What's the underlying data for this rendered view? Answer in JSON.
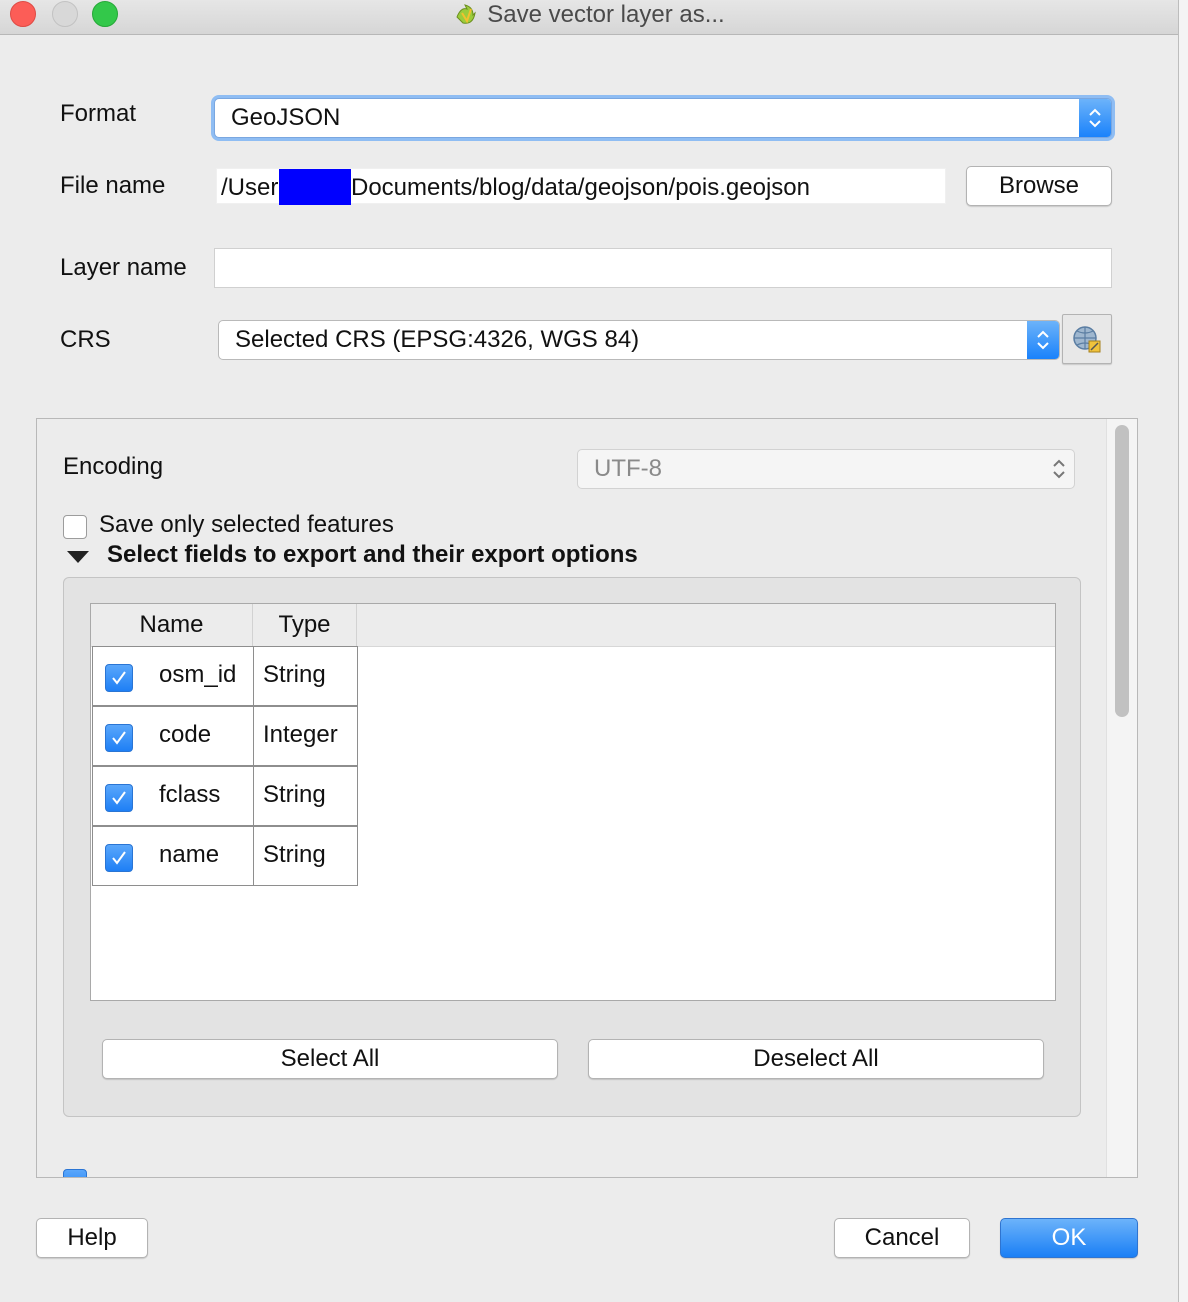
{
  "window": {
    "title": "Save vector layer as..."
  },
  "form": {
    "format_label": "Format",
    "format_value": "GeoJSON",
    "filename_label": "File name",
    "filename_prefix": "/User",
    "filename_suffix": "Documents/blog/data/geojson/pois.geojson",
    "browse_label": "Browse",
    "layername_label": "Layer name",
    "layername_value": "",
    "crs_label": "CRS",
    "crs_value": "Selected CRS (EPSG:4326, WGS 84)"
  },
  "options": {
    "encoding_label": "Encoding",
    "encoding_value": "UTF-8",
    "save_selected_label": "Save only selected features",
    "save_selected_checked": false,
    "fields_section_label": "Select fields to export and their export options",
    "columns": [
      "Name",
      "Type"
    ],
    "fields": [
      {
        "name": "osm_id",
        "type": "String",
        "checked": true
      },
      {
        "name": "code",
        "type": "Integer",
        "checked": true
      },
      {
        "name": "fclass",
        "type": "String",
        "checked": true
      },
      {
        "name": "name",
        "type": "String",
        "checked": true
      }
    ],
    "select_all_label": "Select All",
    "deselect_all_label": "Deselect All"
  },
  "footer": {
    "help_label": "Help",
    "cancel_label": "Cancel",
    "ok_label": "OK"
  },
  "colors": {
    "accent": "#1a82fb",
    "redaction": "#0000ff"
  },
  "icons": [
    "qgis-icon",
    "up-down-arrows-icon",
    "crs-globe-icon",
    "checkmark-icon",
    "disclosure-triangle-icon"
  ]
}
